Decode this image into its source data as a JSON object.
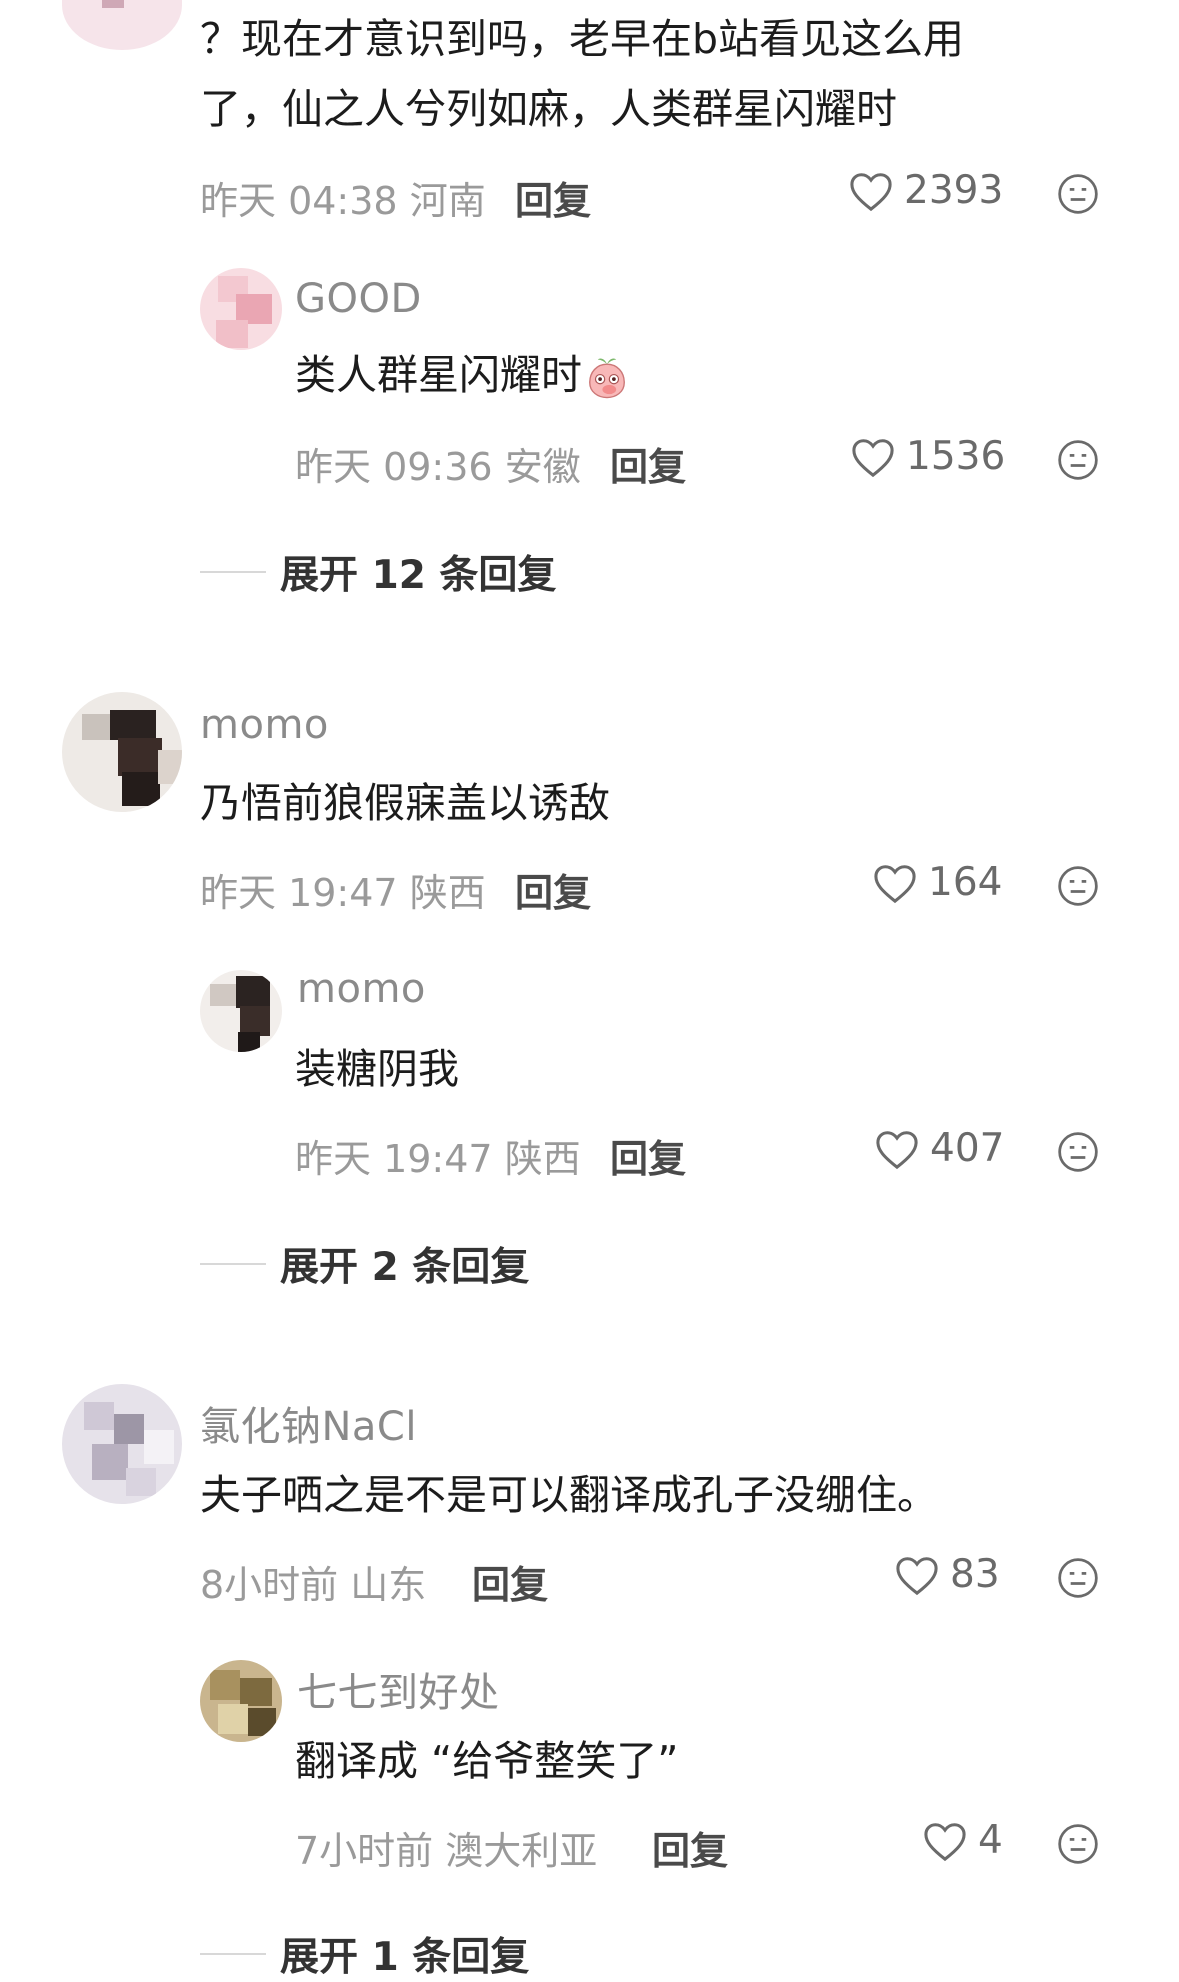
{
  "comments": [
    {
      "text_lines": [
        "？现在才意识到吗，老早在b站看见这么用",
        "了，仙之人兮列如麻，人类群星闪耀时"
      ],
      "time": "昨天 04:38",
      "location": "河南",
      "reply_label": "回复",
      "likes": "2393",
      "replies": [
        {
          "name": "GOOD",
          "text": "类人群星闪耀时",
          "emoji": "peach-face-emoji",
          "time": "昨天 09:36",
          "location": "安徽",
          "reply_label": "回复",
          "likes": "1536"
        }
      ],
      "expand_label": "展开 12 条回复"
    },
    {
      "name": "momo",
      "text": "乃悟前狼假寐盖以诱敌",
      "time": "昨天 19:47",
      "location": "陕西",
      "reply_label": "回复",
      "likes": "164",
      "replies": [
        {
          "name": "momo",
          "text": "装糖阴我",
          "time": "昨天 19:47",
          "location": "陕西",
          "reply_label": "回复",
          "likes": "407"
        }
      ],
      "expand_label": "展开 2 条回复"
    },
    {
      "name": "氯化钠NaCl",
      "text": "夫子哂之是不是可以翻译成孔子没绷住。",
      "time": "8小时前",
      "location": "山东",
      "reply_label": "回复",
      "likes": "83",
      "replies": [
        {
          "name": "七七到好处",
          "text": "翻译成 “给爷整笑了”",
          "time": "7小时前",
          "location": "澳大利亚",
          "reply_label": "回复",
          "likes": "4"
        }
      ],
      "expand_label": "展开 1 条回复"
    }
  ],
  "colors": {
    "text": "#1c1c1c",
    "meta": "#9a9a9a",
    "name": "#8a8a8a",
    "icon": "#6a6a6a"
  }
}
